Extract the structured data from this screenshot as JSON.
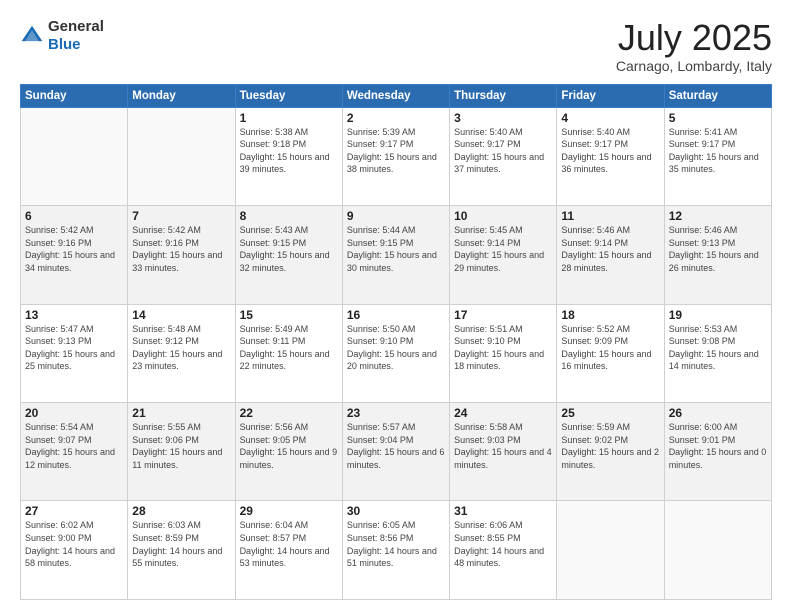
{
  "header": {
    "logo_general": "General",
    "logo_blue": "Blue",
    "month_title": "July 2025",
    "location": "Carnago, Lombardy, Italy"
  },
  "weekdays": [
    "Sunday",
    "Monday",
    "Tuesday",
    "Wednesday",
    "Thursday",
    "Friday",
    "Saturday"
  ],
  "weeks": [
    [
      {
        "day": "",
        "sunrise": "",
        "sunset": "",
        "daylight": ""
      },
      {
        "day": "",
        "sunrise": "",
        "sunset": "",
        "daylight": ""
      },
      {
        "day": "1",
        "sunrise": "Sunrise: 5:38 AM",
        "sunset": "Sunset: 9:18 PM",
        "daylight": "Daylight: 15 hours and 39 minutes."
      },
      {
        "day": "2",
        "sunrise": "Sunrise: 5:39 AM",
        "sunset": "Sunset: 9:17 PM",
        "daylight": "Daylight: 15 hours and 38 minutes."
      },
      {
        "day": "3",
        "sunrise": "Sunrise: 5:40 AM",
        "sunset": "Sunset: 9:17 PM",
        "daylight": "Daylight: 15 hours and 37 minutes."
      },
      {
        "day": "4",
        "sunrise": "Sunrise: 5:40 AM",
        "sunset": "Sunset: 9:17 PM",
        "daylight": "Daylight: 15 hours and 36 minutes."
      },
      {
        "day": "5",
        "sunrise": "Sunrise: 5:41 AM",
        "sunset": "Sunset: 9:17 PM",
        "daylight": "Daylight: 15 hours and 35 minutes."
      }
    ],
    [
      {
        "day": "6",
        "sunrise": "Sunrise: 5:42 AM",
        "sunset": "Sunset: 9:16 PM",
        "daylight": "Daylight: 15 hours and 34 minutes."
      },
      {
        "day": "7",
        "sunrise": "Sunrise: 5:42 AM",
        "sunset": "Sunset: 9:16 PM",
        "daylight": "Daylight: 15 hours and 33 minutes."
      },
      {
        "day": "8",
        "sunrise": "Sunrise: 5:43 AM",
        "sunset": "Sunset: 9:15 PM",
        "daylight": "Daylight: 15 hours and 32 minutes."
      },
      {
        "day": "9",
        "sunrise": "Sunrise: 5:44 AM",
        "sunset": "Sunset: 9:15 PM",
        "daylight": "Daylight: 15 hours and 30 minutes."
      },
      {
        "day": "10",
        "sunrise": "Sunrise: 5:45 AM",
        "sunset": "Sunset: 9:14 PM",
        "daylight": "Daylight: 15 hours and 29 minutes."
      },
      {
        "day": "11",
        "sunrise": "Sunrise: 5:46 AM",
        "sunset": "Sunset: 9:14 PM",
        "daylight": "Daylight: 15 hours and 28 minutes."
      },
      {
        "day": "12",
        "sunrise": "Sunrise: 5:46 AM",
        "sunset": "Sunset: 9:13 PM",
        "daylight": "Daylight: 15 hours and 26 minutes."
      }
    ],
    [
      {
        "day": "13",
        "sunrise": "Sunrise: 5:47 AM",
        "sunset": "Sunset: 9:13 PM",
        "daylight": "Daylight: 15 hours and 25 minutes."
      },
      {
        "day": "14",
        "sunrise": "Sunrise: 5:48 AM",
        "sunset": "Sunset: 9:12 PM",
        "daylight": "Daylight: 15 hours and 23 minutes."
      },
      {
        "day": "15",
        "sunrise": "Sunrise: 5:49 AM",
        "sunset": "Sunset: 9:11 PM",
        "daylight": "Daylight: 15 hours and 22 minutes."
      },
      {
        "day": "16",
        "sunrise": "Sunrise: 5:50 AM",
        "sunset": "Sunset: 9:10 PM",
        "daylight": "Daylight: 15 hours and 20 minutes."
      },
      {
        "day": "17",
        "sunrise": "Sunrise: 5:51 AM",
        "sunset": "Sunset: 9:10 PM",
        "daylight": "Daylight: 15 hours and 18 minutes."
      },
      {
        "day": "18",
        "sunrise": "Sunrise: 5:52 AM",
        "sunset": "Sunset: 9:09 PM",
        "daylight": "Daylight: 15 hours and 16 minutes."
      },
      {
        "day": "19",
        "sunrise": "Sunrise: 5:53 AM",
        "sunset": "Sunset: 9:08 PM",
        "daylight": "Daylight: 15 hours and 14 minutes."
      }
    ],
    [
      {
        "day": "20",
        "sunrise": "Sunrise: 5:54 AM",
        "sunset": "Sunset: 9:07 PM",
        "daylight": "Daylight: 15 hours and 12 minutes."
      },
      {
        "day": "21",
        "sunrise": "Sunrise: 5:55 AM",
        "sunset": "Sunset: 9:06 PM",
        "daylight": "Daylight: 15 hours and 11 minutes."
      },
      {
        "day": "22",
        "sunrise": "Sunrise: 5:56 AM",
        "sunset": "Sunset: 9:05 PM",
        "daylight": "Daylight: 15 hours and 9 minutes."
      },
      {
        "day": "23",
        "sunrise": "Sunrise: 5:57 AM",
        "sunset": "Sunset: 9:04 PM",
        "daylight": "Daylight: 15 hours and 6 minutes."
      },
      {
        "day": "24",
        "sunrise": "Sunrise: 5:58 AM",
        "sunset": "Sunset: 9:03 PM",
        "daylight": "Daylight: 15 hours and 4 minutes."
      },
      {
        "day": "25",
        "sunrise": "Sunrise: 5:59 AM",
        "sunset": "Sunset: 9:02 PM",
        "daylight": "Daylight: 15 hours and 2 minutes."
      },
      {
        "day": "26",
        "sunrise": "Sunrise: 6:00 AM",
        "sunset": "Sunset: 9:01 PM",
        "daylight": "Daylight: 15 hours and 0 minutes."
      }
    ],
    [
      {
        "day": "27",
        "sunrise": "Sunrise: 6:02 AM",
        "sunset": "Sunset: 9:00 PM",
        "daylight": "Daylight: 14 hours and 58 minutes."
      },
      {
        "day": "28",
        "sunrise": "Sunrise: 6:03 AM",
        "sunset": "Sunset: 8:59 PM",
        "daylight": "Daylight: 14 hours and 55 minutes."
      },
      {
        "day": "29",
        "sunrise": "Sunrise: 6:04 AM",
        "sunset": "Sunset: 8:57 PM",
        "daylight": "Daylight: 14 hours and 53 minutes."
      },
      {
        "day": "30",
        "sunrise": "Sunrise: 6:05 AM",
        "sunset": "Sunset: 8:56 PM",
        "daylight": "Daylight: 14 hours and 51 minutes."
      },
      {
        "day": "31",
        "sunrise": "Sunrise: 6:06 AM",
        "sunset": "Sunset: 8:55 PM",
        "daylight": "Daylight: 14 hours and 48 minutes."
      },
      {
        "day": "",
        "sunrise": "",
        "sunset": "",
        "daylight": ""
      },
      {
        "day": "",
        "sunrise": "",
        "sunset": "",
        "daylight": ""
      }
    ]
  ]
}
